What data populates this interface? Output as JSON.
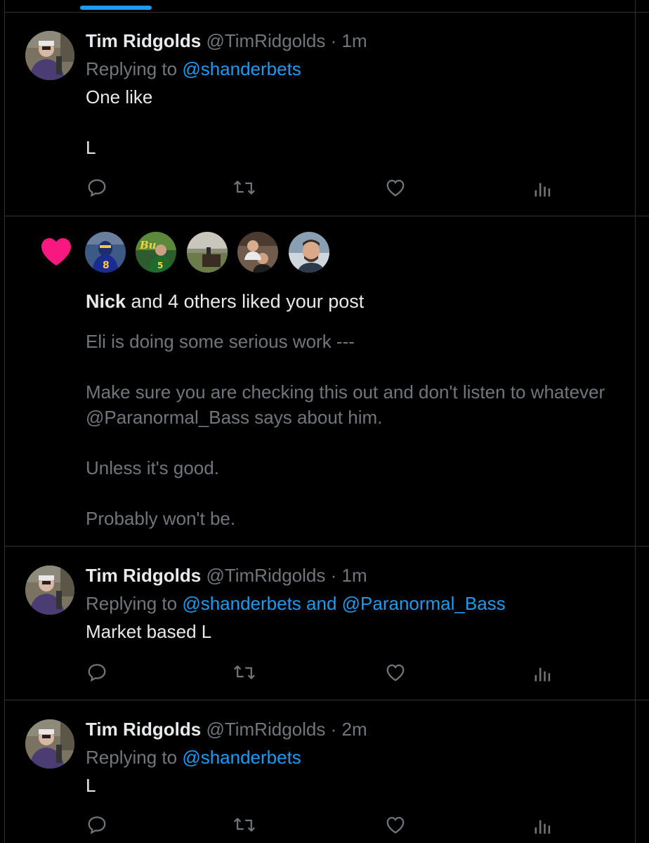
{
  "colors": {
    "background": "#000000",
    "text_primary": "#e7e9ea",
    "text_secondary": "#71767b",
    "accent": "#1d9bf0",
    "like": "#f91880",
    "divider": "#2f3336"
  },
  "tweets": [
    {
      "name": "Tim Ridgolds",
      "handle": "@TimRidgolds",
      "separator": "·",
      "time": "1m",
      "replying_prefix": "Replying to",
      "replying_to": "@shanderbets",
      "text_line1": "One like",
      "text_line2": "L"
    },
    {
      "name": "Tim Ridgolds",
      "handle": "@TimRidgolds",
      "separator": "·",
      "time": "1m",
      "replying_prefix": "Replying to",
      "replying_to": "@shanderbets and @Paranormal_Bass",
      "text_line1": "Market based L"
    },
    {
      "name": "Tim Ridgolds",
      "handle": "@TimRidgolds",
      "separator": "·",
      "time": "2m",
      "replying_prefix": "Replying to",
      "replying_to": "@shanderbets",
      "text_line1": "L"
    }
  ],
  "notification": {
    "actor": "Nick",
    "rest": " and 4 others liked your post",
    "likers": [
      "liker-1",
      "liker-2",
      "liker-3",
      "liker-4",
      "liker-5"
    ],
    "body": [
      "Eli is doing some serious work ---",
      "Make sure you are checking this out and don't listen to whatever",
      "@Paranormal_Bass says about him.",
      "Unless it's good.",
      "Probably won't be."
    ]
  },
  "icons": {
    "reply": "reply-icon",
    "retweet": "retweet-icon",
    "like": "like-icon",
    "views": "views-icon",
    "notification_heart": "heart-filled-icon"
  }
}
